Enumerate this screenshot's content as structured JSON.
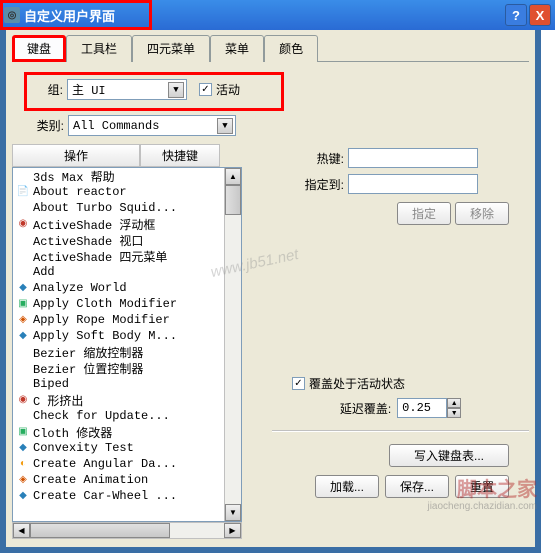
{
  "window": {
    "title": "自定义用户界面",
    "help_glyph": "?",
    "close_glyph": "X"
  },
  "tabs": [
    "键盘",
    "工具栏",
    "四元菜单",
    "菜单",
    "颜色"
  ],
  "group": {
    "label": "组:",
    "value": "主 UI",
    "active_label": "活动",
    "active_checked": "✓"
  },
  "category": {
    "label": "类别:",
    "value": "All Commands"
  },
  "list": {
    "headers": [
      "操作",
      "快捷键"
    ],
    "items": [
      {
        "icon": "",
        "text": "3ds Max 帮助"
      },
      {
        "icon": "doc",
        "text": "About reactor"
      },
      {
        "icon": "",
        "text": "About Turbo Squid..."
      },
      {
        "icon": "red",
        "text": "ActiveShade 浮动框"
      },
      {
        "icon": "",
        "text": "ActiveShade 视口"
      },
      {
        "icon": "",
        "text": "ActiveShade 四元菜单"
      },
      {
        "icon": "",
        "text": "Add"
      },
      {
        "icon": "blue",
        "text": "Analyze World"
      },
      {
        "icon": "green",
        "text": "Apply Cloth Modifier"
      },
      {
        "icon": "orange",
        "text": "Apply Rope Modifier"
      },
      {
        "icon": "blue",
        "text": "Apply Soft Body M..."
      },
      {
        "icon": "",
        "text": "Bezier 缩放控制器"
      },
      {
        "icon": "",
        "text": "Bezier 位置控制器"
      },
      {
        "icon": "",
        "text": "Biped"
      },
      {
        "icon": "red",
        "text": "C 形挤出"
      },
      {
        "icon": "",
        "text": "Check for Update..."
      },
      {
        "icon": "green",
        "text": "Cloth 修改器"
      },
      {
        "icon": "blue",
        "text": "Convexity Test"
      },
      {
        "icon": "yellow",
        "text": "Create Angular Da..."
      },
      {
        "icon": "orange",
        "text": "Create Animation"
      },
      {
        "icon": "blue",
        "text": "Create Car-Wheel ..."
      }
    ]
  },
  "right": {
    "hotkey_label": "热键:",
    "assign_to_label": "指定到:",
    "assign_btn": "指定",
    "remove_btn": "移除",
    "override_label": "覆盖处于活动状态",
    "override_checked": "✓",
    "delay_label": "延迟覆盖:",
    "delay_value": "0.25",
    "write_btn": "写入键盘表...",
    "load_btn": "加载...",
    "save_btn": "保存...",
    "reset_btn": "重置"
  },
  "watermark": {
    "mid": "www.jb51.net",
    "main": "脚本之家",
    "sub": "jiaocheng.chazidian.com"
  }
}
